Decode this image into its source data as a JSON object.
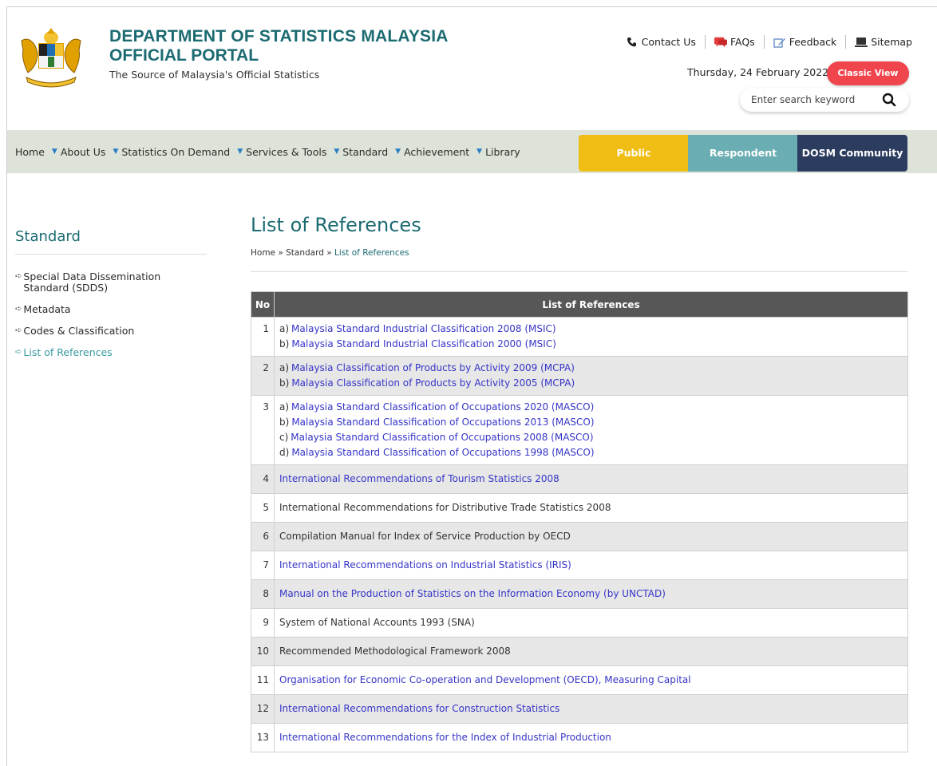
{
  "header": {
    "title_line1": "DEPARTMENT OF STATISTICS MALAYSIA",
    "title_line2": "OFFICIAL PORTAL",
    "tagline": "The Source of Malaysia's Official Statistics",
    "links": {
      "contact": "Contact Us",
      "faqs": "FAQs",
      "feedback": "Feedback",
      "sitemap": "Sitemap"
    },
    "date": "Thursday, 24 February 2022",
    "classic_view": "Classic View",
    "search_placeholder": "Enter search keyword"
  },
  "nav": {
    "items": [
      "Home",
      "About Us",
      "Statistics On Demand",
      "Services & Tools",
      "Standard",
      "Achievement",
      "Library"
    ],
    "audience": {
      "public": "Public",
      "respondent": "Respondent",
      "community": "DOSM Community"
    }
  },
  "sidebar": {
    "title": "Standard",
    "items": [
      "Special Data Dissemination Standard (SDDS)",
      "Metadata",
      "Codes & Classification",
      "List of References"
    ],
    "active_index": 3
  },
  "main": {
    "title": "List of References",
    "breadcrumb": [
      "Home",
      "»",
      "Standard",
      "»",
      "List of References"
    ],
    "table": {
      "headers": [
        "No",
        "List of References"
      ],
      "rows": [
        {
          "no": "1",
          "items": [
            {
              "label": "a)",
              "text": "Malaysia Standard Industrial Classification 2008 (MSIC)",
              "link": true
            },
            {
              "label": "b)",
              "text": "Malaysia Standard Industrial Classification 2000 (MSIC)",
              "link": true
            }
          ]
        },
        {
          "no": "2",
          "items": [
            {
              "label": "a)",
              "text": "Malaysia Classification of Products by Activity 2009 (MCPA)",
              "link": true
            },
            {
              "label": "b)",
              "text": "Malaysia Classification of Products by Activity 2005 (MCPA)",
              "link": true
            }
          ]
        },
        {
          "no": "3",
          "items": [
            {
              "label": "a)",
              "text": "Malaysia Standard Classification of Occupations 2020 (MASCO)",
              "link": true
            },
            {
              "label": "b)",
              "text": "Malaysia Standard Classification of Occupations 2013 (MASCO)",
              "link": true
            },
            {
              "label": "c)",
              "text": "Malaysia Standard Classification of Occupations 2008 (MASCO)",
              "link": true
            },
            {
              "label": "d)",
              "text": "Malaysia Standard Classification of Occupations 1998 (MASCO)",
              "link": true
            }
          ]
        },
        {
          "no": "4",
          "items": [
            {
              "label": "",
              "text": "International Recommendations of Tourism Statistics 2008",
              "link": true
            }
          ]
        },
        {
          "no": "5",
          "items": [
            {
              "label": "",
              "text": "International Recommendations for Distributive Trade Statistics 2008",
              "link": false
            }
          ]
        },
        {
          "no": "6",
          "items": [
            {
              "label": "",
              "text": "Compilation Manual for Index of Service Production by OECD",
              "link": false
            }
          ]
        },
        {
          "no": "7",
          "items": [
            {
              "label": "",
              "text": "International Recommendations on Industrial Statistics (IRIS)",
              "link": true
            }
          ]
        },
        {
          "no": "8",
          "items": [
            {
              "label": "",
              "text": "Manual on the Production of Statistics on the Information Economy (by UNCTAD)",
              "link": true
            }
          ]
        },
        {
          "no": "9",
          "items": [
            {
              "label": "",
              "text": "System of National Accounts 1993 (SNA)",
              "link": false
            }
          ]
        },
        {
          "no": "10",
          "items": [
            {
              "label": "",
              "text": "Recommended Methodological Framework 2008",
              "link": false
            }
          ]
        },
        {
          "no": "11",
          "items": [
            {
              "label": "",
              "text": "Organisation for Economic Co-operation and Development (OECD), Measuring Capital",
              "link": true
            }
          ]
        },
        {
          "no": "12",
          "items": [
            {
              "label": "",
              "text": "International Recommendations for Construction Statistics",
              "link": true
            }
          ]
        },
        {
          "no": "13",
          "items": [
            {
              "label": "",
              "text": "International Recommendations for the Index of Industrial Production",
              "link": true
            }
          ]
        }
      ]
    }
  },
  "colors": {
    "brand_teal": "#1c6b72",
    "classic_red": "#f0454d",
    "public_yellow": "#f0bd14",
    "respondent_teal": "#6aadb3",
    "community_navy": "#2b3c5f",
    "link_blue": "#3535c8",
    "nav_bg": "#dde3d8"
  }
}
